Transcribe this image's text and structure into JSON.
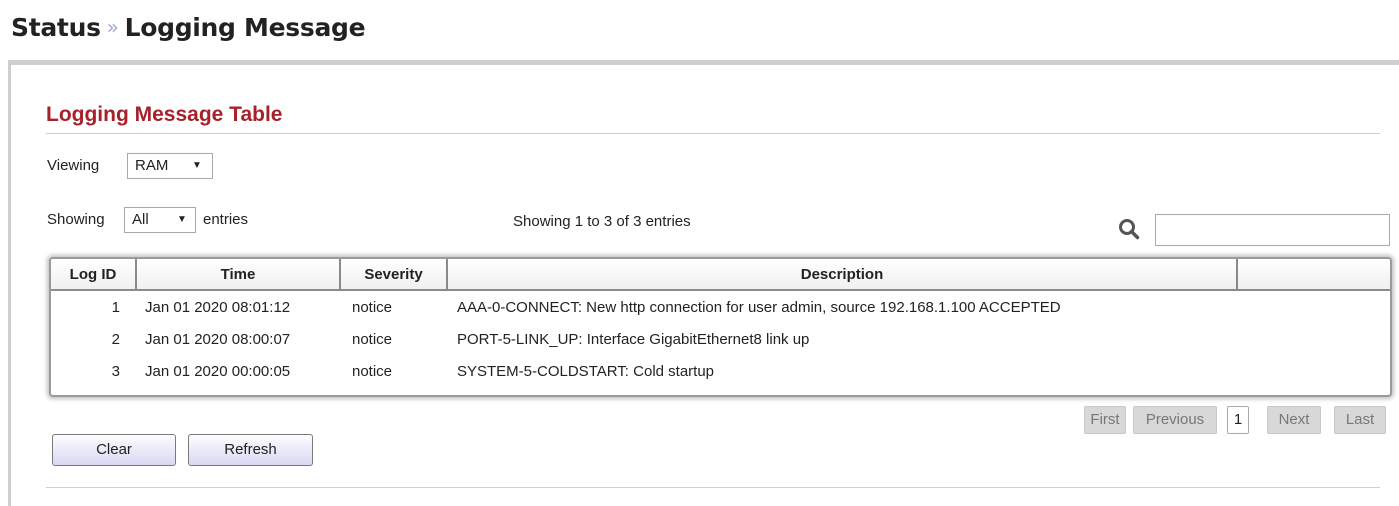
{
  "header": {
    "crumb_parent": "Status",
    "separator": "»",
    "crumb_current": "Logging Message"
  },
  "section": {
    "title": "Logging Message Table"
  },
  "viewing": {
    "label": "Viewing",
    "selected": "RAM"
  },
  "showing": {
    "label": "Showing",
    "selected": "All",
    "suffix": "entries",
    "info": "Showing 1 to 3 of 3 entries"
  },
  "search": {
    "icon": "search-icon",
    "value": ""
  },
  "table": {
    "columns": [
      "Log ID",
      "Time",
      "Severity",
      "Description",
      ""
    ],
    "rows": [
      {
        "id": "1",
        "time": "Jan 01 2020 08:01:12",
        "severity": "notice",
        "description": "AAA-0-CONNECT: New http connection for user admin, source 192.168.1.100 ACCEPTED"
      },
      {
        "id": "2",
        "time": "Jan 01 2020 08:00:07",
        "severity": "notice",
        "description": "PORT-5-LINK_UP: Interface GigabitEthernet8 link up"
      },
      {
        "id": "3",
        "time": "Jan 01 2020 00:00:05",
        "severity": "notice",
        "description": "SYSTEM-5-COLDSTART: Cold startup"
      }
    ]
  },
  "pagination": {
    "first": "First",
    "previous": "Previous",
    "current": "1",
    "next": "Next",
    "last": "Last"
  },
  "buttons": {
    "clear": "Clear",
    "refresh": "Refresh"
  },
  "colors": {
    "section_title": "#a8212a",
    "button_gradient_bottom": "#d8d8f2",
    "pagination_disabled": "#d8d8d8"
  }
}
